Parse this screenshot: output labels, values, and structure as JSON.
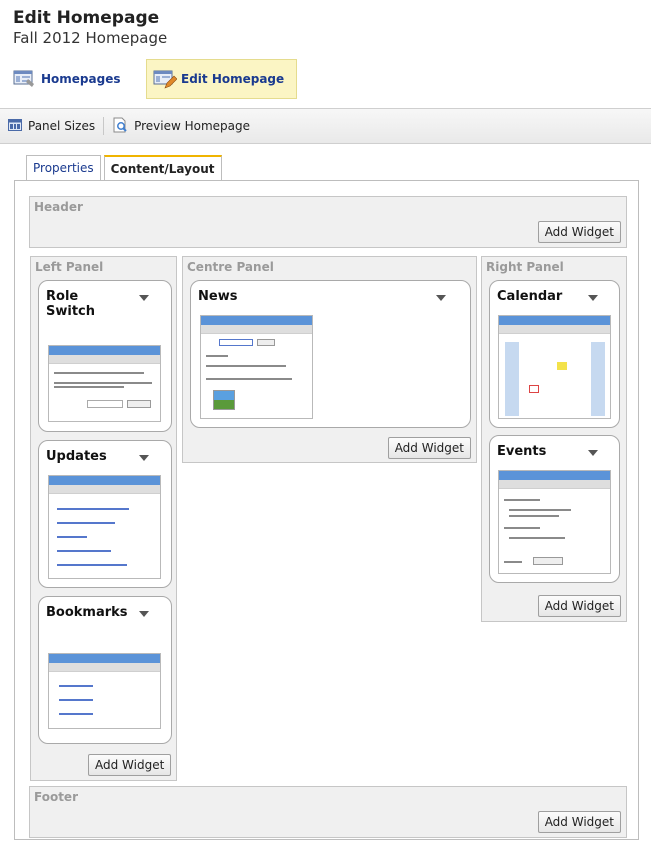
{
  "page": {
    "title": "Edit Homepage",
    "subtitle": "Fall 2012 Homepage"
  },
  "breadcrumbs": [
    {
      "label": "Homepages",
      "icon": "homepages-icon"
    },
    {
      "label": "Edit Homepage",
      "icon": "edit-homepage-icon"
    }
  ],
  "toolbar": {
    "panel_sizes": "Panel Sizes",
    "preview": "Preview Homepage"
  },
  "tabs": [
    {
      "label": "Properties"
    },
    {
      "label": "Content/Layout"
    }
  ],
  "regions": {
    "header": {
      "label": "Header",
      "add": "Add Widget"
    },
    "left": {
      "label": "Left Panel",
      "add": "Add Widget"
    },
    "centre": {
      "label": "Centre Panel",
      "add": "Add Widget"
    },
    "right": {
      "label": "Right Panel",
      "add": "Add Widget"
    },
    "footer": {
      "label": "Footer",
      "add": "Add Widget"
    }
  },
  "widgets": {
    "role_switch": {
      "title": "Role\nSwitch"
    },
    "updates": {
      "title": "Updates"
    },
    "bookmarks": {
      "title": "Bookmarks"
    },
    "news": {
      "title": "News"
    },
    "calendar": {
      "title": "Calendar"
    },
    "events": {
      "title": "Events"
    }
  },
  "colors": {
    "link": "#1a3a8f",
    "active_crumb_bg": "#fbf5c4",
    "tab_accent": "#f0b400",
    "thumb_header": "#5b93d8"
  }
}
